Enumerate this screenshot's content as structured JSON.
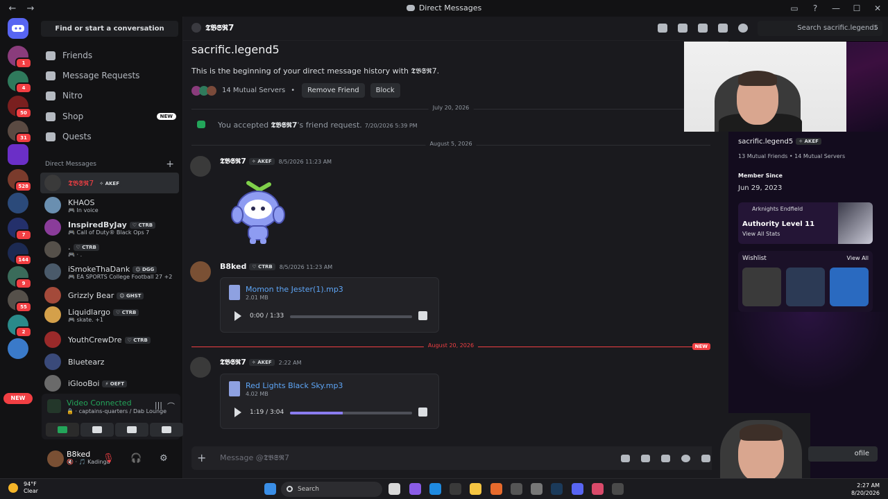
{
  "window": {
    "title": "Direct Messages",
    "back": "←",
    "forward": "→",
    "controls": [
      "▭",
      "?",
      "—",
      "☐",
      "✕"
    ]
  },
  "rail": {
    "badges": [
      "1",
      "4",
      "",
      "50",
      "31",
      "",
      "528",
      "",
      "7",
      "144",
      "9",
      "55",
      "2",
      "",
      ""
    ],
    "new_label": "NEW"
  },
  "sidebar": {
    "search_button": "Find or start a conversation",
    "nav": [
      {
        "label": "Friends"
      },
      {
        "label": "Message Requests"
      },
      {
        "label": "Nitro"
      },
      {
        "label": "Shop",
        "badge": "NEW"
      },
      {
        "label": "Quests"
      }
    ],
    "dm_header": "Direct Messages",
    "dm_add": "+",
    "dms": [
      {
        "name": "𝕿𝕭𝕾𝕽7",
        "tag": "✧ AKEF",
        "sub": ""
      },
      {
        "name": "KHAOS",
        "tag": "",
        "sub": "🎮 In voice"
      },
      {
        "name": "InspiredByJay",
        "tag": "♡ CTRB",
        "sub": "🎮 Call of Duty® Black Ops 7"
      },
      {
        "name": ".",
        "tag": "♡ CTRB",
        "sub": "🎮 · ."
      },
      {
        "name": "iSmokeThaDank",
        "tag": "☺ DGG",
        "sub": "🎮 EA SPORTS College Football 27 +2"
      },
      {
        "name": "Grizzly Bear",
        "tag": "☺ GHST",
        "sub": ""
      },
      {
        "name": "Liquidlargo",
        "tag": "♡ CTRB",
        "sub": "🎮 skate. +1"
      },
      {
        "name": "YouthCrewDre",
        "tag": "♡ CTRB",
        "sub": ""
      },
      {
        "name": "Bluetearz",
        "tag": "",
        "sub": ""
      },
      {
        "name": "iGlooBoi",
        "tag": "⚡ OEFT",
        "sub": ""
      }
    ],
    "voice": {
      "title": "Video Connected",
      "location": "🔒 · captains-quarters / Dab Lounge",
      "wave": "|||",
      "hangup": "⌒"
    },
    "user": {
      "name": "B8ked",
      "status": "🔇 · 🎵 Kadinga",
      "mute": "🎙",
      "deafen": "🎧",
      "settings": "⚙"
    }
  },
  "main": {
    "channel_name": "𝕿𝕭𝕾𝕽7",
    "search_placeholder": "Search sacrific.legend5",
    "search_icon": "⌕",
    "intro": {
      "username": "sacrific.legend5",
      "history": "This is the beginning of your direct message history with 𝕿𝕭𝕾𝕽7.",
      "mutual": "14 Mutual Servers",
      "bullet": "•",
      "remove_friend": "Remove Friend",
      "block": "Block"
    },
    "dividers": {
      "d1": "July 20, 2026",
      "d2": "August 5, 2026",
      "d3": "August 20, 2026",
      "new": "NEW"
    },
    "system": {
      "pre": "You accepted ",
      "name": "𝕿𝕭𝕾𝕽7",
      "post": "'s friend request.",
      "time": "7/20/2026 5:39 PM"
    },
    "messages": [
      {
        "author": "𝕿𝕭𝕾𝕽7",
        "tag": "✧ AKEF",
        "time": "8/5/2026 11:23 AM"
      },
      {
        "author": "B8ked",
        "tag": "♡ CTRB",
        "time": "8/5/2026 11:23 AM",
        "file": {
          "name": "Momon the Jester(1).mp3",
          "size": "2.01 MB",
          "time": "0:00 / 1:33",
          "progress": 0.0
        }
      },
      {
        "author": "𝕿𝕭𝕾𝕽7",
        "tag": "✧ AKEF",
        "time": "2:22 AM",
        "file": {
          "name": "Red Lights Black Sky.mp3",
          "size": "4.02 MB",
          "time": "1:19 / 3:04",
          "progress": 0.43
        }
      }
    ],
    "composer": {
      "plus": "+",
      "placeholder": "Message @𝕿𝕭𝕾𝕽7"
    }
  },
  "profile": {
    "username": "sacrific.legend5",
    "tag": "✧ AKEF",
    "mutuals": "13 Mutual Friends • 14 Mutual Servers",
    "member_since_label": "Member Since",
    "member_since": "Jun 29, 2023",
    "game": {
      "name": "Arknights Endfield",
      "level": "Authority Level 11",
      "stats": "View All Stats"
    },
    "wishlist_label": "Wishlist",
    "wishlist_all": "View All",
    "view_profile": "ofile"
  },
  "taskbar": {
    "temp": "94°F",
    "cond": "Clear",
    "search": "Search",
    "time": "2:27 AM",
    "date": "8/20/2026"
  },
  "colors": {
    "accent": "#5865f2",
    "online": "#23a55a",
    "danger": "#f23f43",
    "link": "#5ea6f7",
    "progress": "#8a7cf0"
  }
}
